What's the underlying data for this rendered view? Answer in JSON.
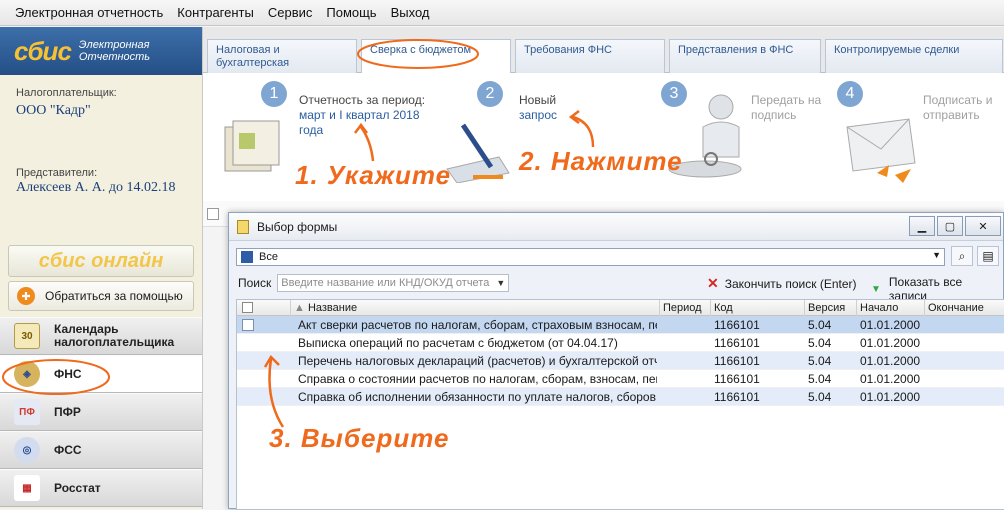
{
  "menu": [
    "Электронная отчетность",
    "Контрагенты",
    "Сервис",
    "Помощь",
    "Выход"
  ],
  "logo": {
    "brand": "сбис",
    "subtitle_line1": "Электронная",
    "subtitle_line2": "Отчетность"
  },
  "taxpayer": {
    "label": "Налогоплательщик:",
    "value": "ООО \"Кадр\""
  },
  "representative": {
    "label": "Представители:",
    "value": "Алексеев А. А. до 14.02.18"
  },
  "online_label": "сбис онлайн",
  "help_label": "Обратиться за помощью",
  "nav": [
    {
      "label": "Календарь налогоплательщика",
      "icon": "calendar-icon"
    },
    {
      "label": "ФНС",
      "icon": "fns-emblem-icon"
    },
    {
      "label": "ПФР",
      "icon": "pfr-icon"
    },
    {
      "label": "ФСС",
      "icon": "fss-icon"
    },
    {
      "label": "Росстат",
      "icon": "rosstat-icon"
    }
  ],
  "calendar_day": "30",
  "tabs": [
    {
      "line1": "Налоговая и",
      "line2": "бухгалтерская отчетность"
    },
    {
      "line1": "Сверка с бюджетом",
      "line2": ""
    },
    {
      "line1": "Требования ФНС",
      "line2": ""
    },
    {
      "line1": "Представления в ФНС",
      "line2": ""
    },
    {
      "line1": "Контролируемые сделки",
      "line2": ""
    }
  ],
  "steps": [
    {
      "num": "1",
      "line1": "Отчетность за период:",
      "line2": "март и I квартал 2018",
      "line3": "года"
    },
    {
      "num": "2",
      "line1": "Новый",
      "line2": "запрос",
      "line3": ""
    },
    {
      "num": "3",
      "line1": "Передать на",
      "line2": "подпись",
      "line3": ""
    },
    {
      "num": "4",
      "line1": "Подписать и",
      "line2": "отправить",
      "line3": ""
    }
  ],
  "annotations": {
    "a1": "1. Укажите",
    "a2": "2. Нажмите",
    "a3": "3. Выберите"
  },
  "dialog": {
    "title": "Выбор формы",
    "filter_value": "Все",
    "search_label": "Поиск",
    "search_placeholder": "Введите название или КНД/ОКУД отчета",
    "finish_search": "Закончить поиск (Enter)",
    "show_all": "Показать все записи",
    "columns": [
      "Название",
      "Период",
      "Код",
      "Версия",
      "Начало",
      "Окончание"
    ],
    "rows": [
      {
        "name": "Акт сверки расчетов по налогам, сборам, страховым взносам, пеням",
        "period": "",
        "code": "1166101",
        "version": "5.04",
        "start": "01.01.2000",
        "end": ""
      },
      {
        "name": "Выписка операций по расчетам с бюджетом (от 04.04.17)",
        "period": "",
        "code": "1166101",
        "version": "5.04",
        "start": "01.01.2000",
        "end": ""
      },
      {
        "name": "Перечень налоговых деклараций (расчетов) и бухгалтерской отчетност",
        "period": "",
        "code": "1166101",
        "version": "5.04",
        "start": "01.01.2000",
        "end": ""
      },
      {
        "name": "Справка о состоянии расчетов по налогам, сборам, взносам, пеням, ш",
        "period": "",
        "code": "1166101",
        "version": "5.04",
        "start": "01.01.2000",
        "end": ""
      },
      {
        "name": "Справка об исполнении обязанности по уплате налогов, сборов, взно",
        "period": "",
        "code": "1166101",
        "version": "5.04",
        "start": "01.01.2000",
        "end": ""
      }
    ]
  },
  "colors": {
    "accent": "#ef6a1c",
    "brand_blue": "#2a5d9f",
    "logo_yellow": "#f6c233"
  }
}
